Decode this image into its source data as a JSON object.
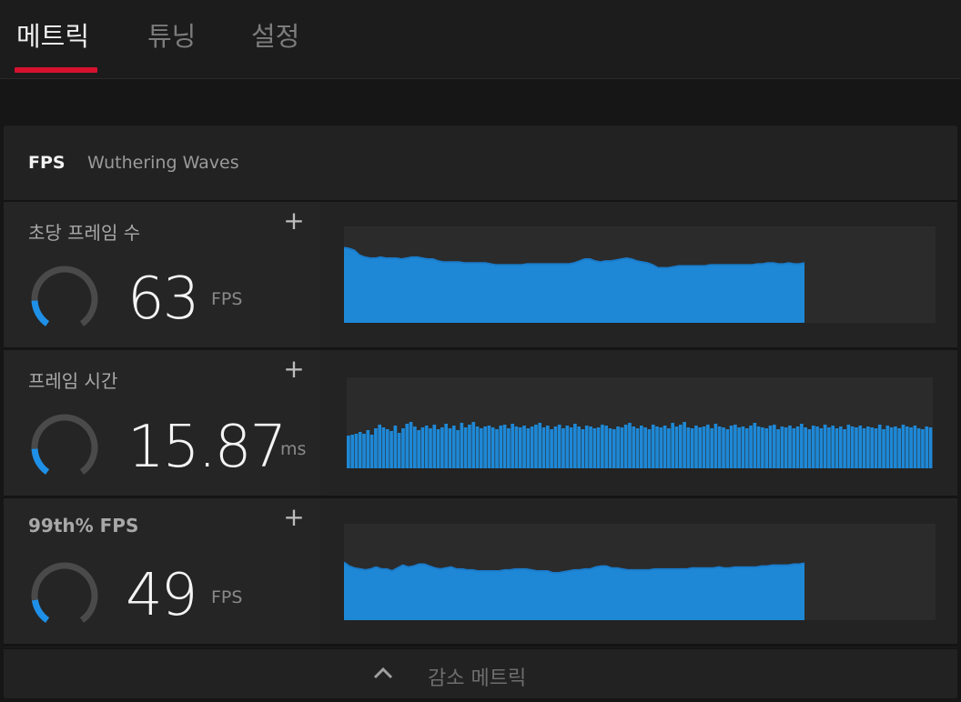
{
  "tabs": [
    {
      "label": "메트릭",
      "active": true
    },
    {
      "label": "튜닝",
      "active": false
    },
    {
      "label": "설정",
      "active": false
    }
  ],
  "panel": {
    "header_label": "FPS",
    "game_name": "Wuthering Waves"
  },
  "metrics": [
    {
      "title": "초당 프레임 수",
      "value": "63",
      "unit": "FPS",
      "gauge_fraction": 0.18,
      "history": [
        78,
        77,
        75,
        70,
        68,
        67,
        67,
        68,
        67,
        67,
        67,
        66,
        67,
        68,
        68,
        67,
        66,
        66,
        64,
        63,
        63,
        63,
        63,
        62,
        62,
        62,
        62,
        62,
        61,
        60,
        60,
        60,
        60,
        60,
        60,
        61,
        61,
        61,
        61,
        61,
        61,
        61,
        61,
        61,
        62,
        64,
        66,
        66,
        64,
        63,
        64,
        64,
        65,
        66,
        67,
        66,
        64,
        63,
        62,
        60,
        57,
        57,
        57,
        58,
        59,
        59,
        59,
        59,
        59,
        59,
        60,
        60,
        60,
        60,
        60,
        60,
        60,
        60,
        60,
        61,
        61,
        62,
        62,
        61,
        61,
        62,
        61,
        61,
        62
      ],
      "history_max": 100
    },
    {
      "title": "프레임 시간",
      "value": "15.87",
      "unit": "ms",
      "gauge_fraction": 0.18,
      "history": [
        36,
        37,
        38,
        40,
        38,
        42,
        37,
        44,
        48,
        45,
        43,
        41,
        47,
        39,
        44,
        49,
        51,
        46,
        42,
        45,
        47,
        44,
        48,
        43,
        45,
        49,
        44,
        47,
        42,
        50,
        45,
        48,
        51,
        46,
        44,
        46,
        47,
        45,
        43,
        47,
        48,
        44,
        49,
        46,
        45,
        47,
        44,
        46,
        48,
        50,
        45,
        47,
        43,
        46,
        48,
        44,
        47,
        45,
        49,
        46,
        43,
        47,
        46,
        44,
        45,
        48,
        47,
        44,
        43,
        46,
        45,
        48,
        50,
        46,
        44,
        47,
        45,
        43,
        48,
        46,
        45,
        47,
        44,
        50,
        46,
        48,
        51,
        45,
        44,
        47,
        45,
        46,
        48,
        44,
        49,
        46,
        45,
        43,
        47,
        48,
        45,
        46,
        44,
        47,
        50,
        46,
        45,
        44,
        47,
        48,
        43,
        46,
        45,
        47,
        44,
        46,
        49,
        45,
        43,
        47,
        46,
        44,
        48,
        45,
        47,
        44,
        46,
        43,
        48,
        46,
        45,
        47,
        44,
        46,
        45,
        44,
        48,
        43,
        47,
        45,
        46,
        44,
        48,
        46,
        45,
        47,
        44,
        43,
        46,
        45
      ],
      "history_max": 100
    },
    {
      "title": "99th% FPS",
      "value": "49",
      "unit": "FPS",
      "gauge_fraction": 0.16,
      "history": [
        60,
        56,
        54,
        53,
        52,
        53,
        55,
        53,
        53,
        51,
        54,
        57,
        55,
        56,
        58,
        58,
        56,
        54,
        53,
        54,
        55,
        53,
        53,
        52,
        52,
        51,
        51,
        51,
        51,
        51,
        52,
        52,
        53,
        53,
        53,
        52,
        51,
        51,
        51,
        49,
        49,
        50,
        51,
        52,
        52,
        53,
        53,
        55,
        56,
        56,
        54,
        54,
        53,
        52,
        52,
        52,
        52,
        52,
        53,
        53,
        53,
        53,
        53,
        53,
        53,
        54,
        54,
        54,
        54,
        54,
        55,
        54,
        54,
        55,
        55,
        55,
        55,
        55,
        56,
        56,
        57,
        57,
        57,
        57,
        58,
        58,
        59
      ],
      "history_max": 100
    }
  ],
  "footer": {
    "label": "감소 메트릭",
    "chevron_icon": "chevron-up-icon"
  },
  "colors": {
    "accent": "#d6112f",
    "graph_fill": "#1e88d6",
    "graph_line": "#1a7ccc",
    "gauge_track": "#4a4a4a",
    "gauge_active": "#1e90e8"
  }
}
